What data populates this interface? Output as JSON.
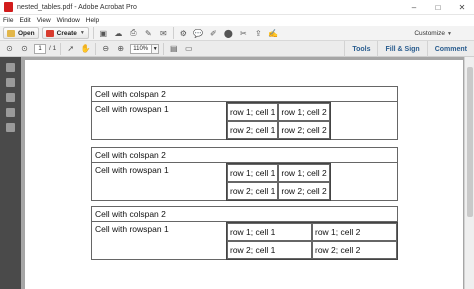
{
  "window": {
    "title": "nested_tables.pdf - Adobe Acrobat Pro",
    "controls": [
      "–",
      "□",
      "✕"
    ]
  },
  "menu": [
    "File",
    "Edit",
    "View",
    "Window",
    "Help"
  ],
  "toolbar": {
    "open_label": "Open",
    "create_label": "Create",
    "customize_label": "Customize"
  },
  "nav": {
    "page_current": "1",
    "page_total": "/ 1",
    "zoom": "110%"
  },
  "panels": {
    "tools": "Tools",
    "fill_sign": "Fill & Sign",
    "comment": "Comment"
  },
  "document": {
    "tables": [
      {
        "header": "Cell with colspan 2",
        "rowspan_label": "Cell with rowspan 1",
        "rows": [
          [
            "row 1; cell 1",
            "row 1; cell 2"
          ],
          [
            "row 2; cell 1",
            "row 2; cell 2"
          ]
        ]
      },
      {
        "header": "Cell with colspan 2",
        "rowspan_label": "Cell with rowspan 1",
        "rows": [
          [
            "row 1; cell 1",
            "row 1; cell 2"
          ],
          [
            "row 2; cell 1",
            "row 2; cell 2"
          ]
        ]
      },
      {
        "header": "Cell with colspan 2",
        "rowspan_label": "Cell with rowspan 1",
        "rows": [
          [
            "row 1; cell 1",
            "row 1; cell 2"
          ],
          [
            "row 2; cell 1",
            "row 2; cell 2"
          ]
        ]
      }
    ]
  }
}
